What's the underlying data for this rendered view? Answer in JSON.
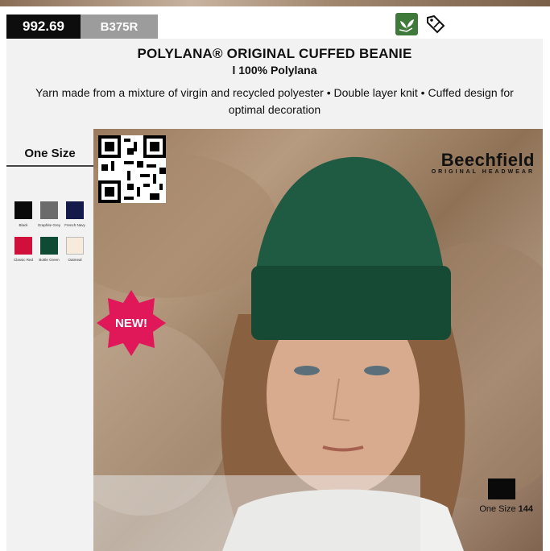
{
  "header": {
    "price": "992.69",
    "sku": "B375R",
    "title": "POLYLANA® ORIGINAL CUFFED BEANIE",
    "subtitle": "l 100% Polylana",
    "description": "Yarn made from a mixture of virgin and recycled polyester • Double layer knit • Cuffed design for optimal decoration"
  },
  "icons": {
    "eco": "eco-leaf-icon",
    "tag": "sale-tag-icon"
  },
  "sidebar": {
    "size_heading": "One Size",
    "swatches": [
      {
        "name": "Black",
        "color": "#0a0a0a"
      },
      {
        "name": "Graphite Grey",
        "color": "#6b6b6b"
      },
      {
        "name": "French Navy",
        "color": "#141a4a"
      },
      {
        "name": "Classic Red",
        "color": "#d0103a"
      },
      {
        "name": "Bottle Green",
        "color": "#0f4a35"
      },
      {
        "name": "Oatmeal",
        "color": "#f7ebdc"
      }
    ]
  },
  "photo": {
    "brand_main": "Beechfield",
    "brand_sub": "ORIGINAL HEADWEAR",
    "badge": "NEW!",
    "size_label": "One Size",
    "size_count": "144"
  },
  "colors": {
    "header_bg": "#f2f2f2",
    "badge": "#e0185a",
    "eco": "#3f7a3a"
  }
}
